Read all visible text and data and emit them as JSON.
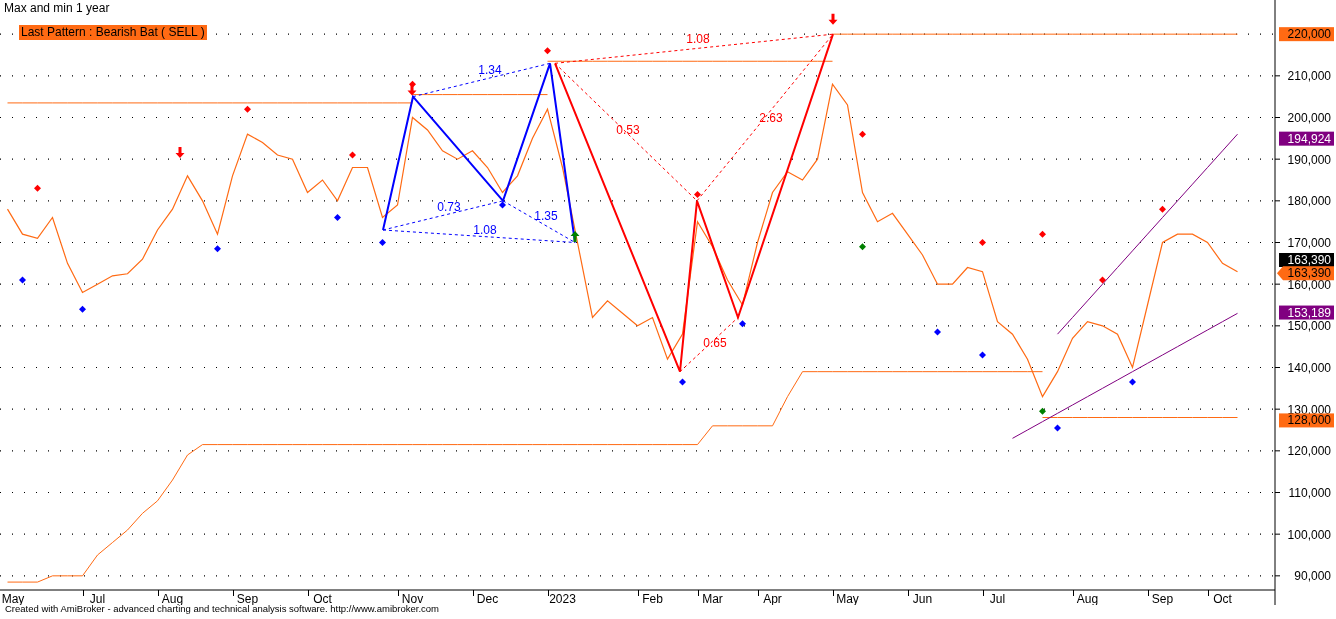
{
  "title": "Max and min 1 year",
  "pattern_badge": "Last Pattern : Bearish Bat ( SELL )",
  "chart_data": {
    "type": "line",
    "ylim": [
      86600,
      228200
    ],
    "grid": true,
    "categories": [
      "May",
      null,
      null,
      null,
      null,
      null,
      "Jul",
      null,
      null,
      null,
      null,
      "Aug",
      null,
      null,
      null,
      null,
      "Sep",
      null,
      null,
      null,
      null,
      "Oct",
      null,
      null,
      null,
      null,
      null,
      "Nov",
      null,
      null,
      null,
      null,
      "Dec",
      null,
      null,
      null,
      null,
      "2023",
      null,
      null,
      null,
      null,
      null,
      "Feb",
      null,
      null,
      null,
      "Mar",
      null,
      null,
      null,
      "Apr",
      null,
      null,
      null,
      null,
      "May",
      null,
      null,
      null,
      null,
      "Jun",
      null,
      null,
      null,
      null,
      "Jul",
      null,
      null,
      null,
      null,
      null,
      "Aug",
      null,
      null,
      null,
      null,
      "Sep",
      null,
      null,
      null,
      "Oct",
      null,
      null,
      null
    ],
    "yticks": [
      {
        "value": 90000,
        "label": "90,000"
      },
      {
        "value": 100000,
        "label": "100,000"
      },
      {
        "value": 110000,
        "label": "110,000"
      },
      {
        "value": 120000,
        "label": "120,000"
      },
      {
        "value": 130000,
        "label": "130,000"
      },
      {
        "value": 140000,
        "label": "140,000"
      },
      {
        "value": 150000,
        "label": "150,000"
      },
      {
        "value": 160000,
        "label": "160,000"
      },
      {
        "value": 170000,
        "label": "170,000"
      },
      {
        "value": 180000,
        "label": "180,000"
      },
      {
        "value": 190000,
        "label": "190,000"
      },
      {
        "value": 200000,
        "label": "200,000"
      },
      {
        "value": 210000,
        "label": "210,000"
      }
    ],
    "series": [
      {
        "color": "#ff6a13",
        "values": [
          178000,
          172000,
          171000,
          176000,
          165000,
          158000,
          160000,
          162000,
          162500,
          166000,
          173000,
          178000,
          186000,
          180000,
          172000,
          186000,
          196000,
          194000,
          191000,
          190000,
          182000,
          185000,
          180000,
          188000,
          188000,
          176000,
          179000,
          200000,
          197000,
          192000,
          190000,
          192000,
          188000,
          182000,
          186000,
          195000,
          202000,
          188000,
          170000,
          152000,
          156000,
          153000,
          150000,
          152000,
          142000,
          148000,
          175000,
          169000,
          161000,
          155000,
          170000,
          182000,
          187000,
          185000,
          190000,
          208000,
          203000,
          182000,
          175000,
          177000,
          172000,
          167000,
          160000,
          160000,
          164000,
          163000,
          151000,
          148000,
          142000,
          133000,
          139000,
          147000,
          151000,
          150000,
          148000,
          140000,
          155000,
          170000,
          172000,
          172000,
          170000,
          165000,
          163000,
          null,
          null
        ]
      },
      {
        "color": "#ff6a13",
        "values": [
          88500,
          88500,
          88500,
          90000,
          90000,
          90000,
          95000,
          98000,
          101000,
          105000,
          108000,
          113000,
          119000,
          121500,
          121500,
          121500,
          121500,
          121500,
          121500,
          121500,
          121500,
          121500,
          121500,
          121500,
          121500,
          121500,
          121500,
          121500,
          121500,
          121500,
          121500,
          121500,
          121500,
          121500,
          121500,
          121500,
          121500,
          121500,
          121500,
          121500,
          121500,
          121500,
          121500,
          121500,
          121500,
          121500,
          121500,
          126000,
          126000,
          126000,
          126000,
          126000,
          133000,
          139000,
          139000,
          139000,
          139000,
          139000,
          139000,
          139000,
          139000,
          139000,
          139000,
          139000,
          139000,
          139000,
          139000,
          139000,
          139000,
          139000,
          null,
          null,
          null,
          null,
          null,
          null,
          null,
          null,
          null,
          null,
          null,
          null,
          null,
          null,
          null
        ]
      },
      {
        "color": "#ff6a13",
        "values": [
          203500,
          203500,
          203500,
          203500,
          203500,
          203500,
          203500,
          203500,
          203500,
          203500,
          203500,
          203500,
          203500,
          203500,
          203500,
          203500,
          203500,
          203500,
          203500,
          203500,
          203500,
          203500,
          203500,
          203500,
          203500,
          203500,
          203500,
          203500,
          null,
          null,
          null,
          null,
          null,
          null,
          null,
          null,
          null,
          null,
          null,
          null,
          null,
          null,
          null,
          null,
          null,
          null,
          null,
          null,
          null,
          null,
          null,
          null,
          null,
          null,
          null,
          null,
          null,
          null,
          null,
          null,
          null,
          null,
          null,
          null,
          null,
          null,
          null,
          null,
          null,
          null,
          null,
          null,
          null,
          null,
          null,
          null,
          null,
          null,
          null,
          null,
          null,
          null,
          null,
          null,
          null
        ]
      },
      {
        "color": "#ff6a13",
        "values": [
          null,
          null,
          null,
          null,
          null,
          null,
          null,
          null,
          null,
          null,
          null,
          null,
          null,
          null,
          null,
          null,
          null,
          null,
          null,
          null,
          null,
          null,
          null,
          null,
          null,
          null,
          null,
          205500,
          205500,
          205500,
          205500,
          205500,
          205500,
          205500,
          205500,
          205500,
          205500,
          null,
          null,
          null,
          null,
          null,
          null,
          null,
          null,
          null,
          null,
          null,
          null,
          null,
          null,
          null,
          null,
          null,
          null,
          null,
          null,
          null,
          null,
          null,
          null,
          null,
          null,
          null,
          null,
          null,
          null,
          null,
          null,
          null,
          null,
          null,
          null,
          null,
          null,
          null,
          null,
          null,
          null,
          null,
          null,
          null,
          null,
          null,
          null
        ]
      },
      {
        "color": "#ff6a13",
        "values": [
          null,
          null,
          null,
          null,
          null,
          null,
          null,
          null,
          null,
          null,
          null,
          null,
          null,
          null,
          null,
          null,
          null,
          null,
          null,
          null,
          null,
          null,
          null,
          null,
          null,
          null,
          null,
          null,
          null,
          null,
          null,
          null,
          null,
          null,
          null,
          null,
          213500,
          213500,
          213500,
          213500,
          213500,
          213500,
          213500,
          213500,
          213500,
          213500,
          213500,
          213500,
          213500,
          213500,
          213500,
          213500,
          213500,
          213500,
          213500,
          213500,
          null,
          null,
          null,
          null,
          null,
          null,
          null,
          null,
          null,
          null,
          null,
          null,
          null,
          null,
          null,
          null,
          null,
          null,
          null,
          null,
          null,
          null,
          null,
          null,
          null,
          null,
          null,
          null,
          null
        ]
      },
      {
        "color": "#ff6a13",
        "values": [
          null,
          null,
          null,
          null,
          null,
          null,
          null,
          null,
          null,
          null,
          null,
          null,
          null,
          null,
          null,
          null,
          null,
          null,
          null,
          null,
          null,
          null,
          null,
          null,
          null,
          null,
          null,
          null,
          null,
          null,
          null,
          null,
          null,
          null,
          null,
          null,
          null,
          null,
          null,
          null,
          null,
          null,
          null,
          null,
          null,
          null,
          null,
          null,
          null,
          null,
          null,
          null,
          null,
          null,
          null,
          220000,
          220000,
          220000,
          220000,
          220000,
          220000,
          220000,
          220000,
          220000,
          220000,
          220000,
          220000,
          220000,
          220000,
          220000,
          220000,
          220000,
          220000,
          220000,
          220000,
          220000,
          220000,
          220000,
          220000,
          220000,
          220000,
          220000,
          220000,
          null,
          null
        ]
      },
      {
        "color": "#ff6a13",
        "values": [
          null,
          null,
          null,
          null,
          null,
          null,
          null,
          null,
          null,
          null,
          null,
          null,
          null,
          null,
          null,
          null,
          null,
          null,
          null,
          null,
          null,
          null,
          null,
          null,
          null,
          null,
          null,
          null,
          null,
          null,
          null,
          null,
          null,
          null,
          null,
          null,
          null,
          null,
          null,
          null,
          null,
          null,
          null,
          null,
          null,
          null,
          null,
          null,
          null,
          null,
          null,
          null,
          null,
          null,
          null,
          null,
          null,
          null,
          null,
          null,
          null,
          null,
          null,
          null,
          null,
          null,
          null,
          null,
          null,
          128000,
          128000,
          128000,
          128000,
          128000,
          128000,
          128000,
          128000,
          128000,
          128000,
          128000,
          128000,
          128000,
          128000,
          null,
          null
        ]
      },
      {
        "color": "#800080",
        "values": [
          null,
          null,
          null,
          null,
          null,
          null,
          null,
          null,
          null,
          null,
          null,
          null,
          null,
          null,
          null,
          null,
          null,
          null,
          null,
          null,
          null,
          null,
          null,
          null,
          null,
          null,
          null,
          null,
          null,
          null,
          null,
          null,
          null,
          null,
          null,
          null,
          null,
          null,
          null,
          null,
          null,
          null,
          null,
          null,
          null,
          null,
          null,
          null,
          null,
          null,
          null,
          null,
          null,
          null,
          null,
          null,
          null,
          null,
          null,
          null,
          null,
          null,
          null,
          null,
          null,
          null,
          null,
          null,
          null,
          null,
          148000,
          152000,
          156000,
          160000,
          164000,
          168000,
          172000,
          176000,
          180000,
          184000,
          188000,
          192000,
          196000,
          null,
          null
        ]
      },
      {
        "color": "#800080",
        "values": [
          null,
          null,
          null,
          null,
          null,
          null,
          null,
          null,
          null,
          null,
          null,
          null,
          null,
          null,
          null,
          null,
          null,
          null,
          null,
          null,
          null,
          null,
          null,
          null,
          null,
          null,
          null,
          null,
          null,
          null,
          null,
          null,
          null,
          null,
          null,
          null,
          null,
          null,
          null,
          null,
          null,
          null,
          null,
          null,
          null,
          null,
          null,
          null,
          null,
          null,
          null,
          null,
          null,
          null,
          null,
          null,
          null,
          null,
          null,
          null,
          null,
          null,
          null,
          null,
          null,
          null,
          null,
          123000,
          125000,
          127000,
          129000,
          131000,
          133000,
          135000,
          137000,
          139000,
          141000,
          143000,
          145000,
          147000,
          149000,
          151000,
          153000,
          null,
          null
        ]
      },
      {
        "type": "scatter",
        "color": "#ff0000",
        "values": [
          null,
          null,
          183000,
          null,
          null,
          null,
          null,
          null,
          null,
          null,
          null,
          null,
          null,
          null,
          null,
          null,
          202000,
          null,
          null,
          null,
          null,
          null,
          null,
          191000,
          null,
          null,
          null,
          208000,
          null,
          null,
          null,
          null,
          null,
          null,
          null,
          null,
          216000,
          null,
          null,
          null,
          null,
          null,
          null,
          null,
          null,
          null,
          181500,
          null,
          null,
          null,
          null,
          null,
          null,
          null,
          null,
          null,
          null,
          196000,
          null,
          null,
          null,
          null,
          null,
          null,
          null,
          170000,
          null,
          null,
          null,
          172000,
          null,
          null,
          null,
          161000,
          null,
          null,
          null,
          178000,
          null,
          null,
          null,
          null,
          null,
          null,
          null
        ]
      },
      {
        "type": "scatter",
        "color": "#0000ff",
        "values": [
          null,
          161000,
          null,
          null,
          null,
          154000,
          null,
          null,
          null,
          null,
          null,
          null,
          null,
          null,
          168500,
          null,
          null,
          null,
          null,
          null,
          null,
          null,
          176000,
          null,
          null,
          170000,
          null,
          null,
          null,
          null,
          null,
          null,
          null,
          179000,
          null,
          null,
          null,
          null,
          null,
          null,
          null,
          null,
          null,
          null,
          null,
          136500,
          null,
          null,
          null,
          150500,
          null,
          null,
          null,
          null,
          null,
          null,
          null,
          null,
          null,
          null,
          null,
          null,
          148500,
          null,
          null,
          143000,
          null,
          null,
          null,
          null,
          125500,
          null,
          null,
          null,
          null,
          136500,
          null,
          null,
          null,
          null,
          null,
          null,
          null,
          null,
          null
        ]
      },
      {
        "type": "scatter",
        "color": "#008000",
        "values": [
          null,
          null,
          null,
          null,
          null,
          null,
          null,
          null,
          null,
          null,
          null,
          null,
          null,
          null,
          null,
          null,
          null,
          null,
          null,
          null,
          null,
          null,
          null,
          null,
          null,
          null,
          null,
          null,
          null,
          null,
          null,
          null,
          null,
          null,
          null,
          null,
          null,
          null,
          null,
          null,
          null,
          null,
          null,
          null,
          null,
          null,
          null,
          null,
          null,
          null,
          null,
          null,
          null,
          null,
          null,
          null,
          null,
          169000,
          null,
          null,
          null,
          null,
          null,
          null,
          null,
          null,
          null,
          null,
          null,
          129500,
          null,
          null,
          null,
          null,
          null,
          null,
          null,
          null,
          null,
          null,
          null,
          null,
          null,
          null,
          null
        ]
      }
    ],
    "annotations": [
      "1.34",
      "0.73",
      "1.08",
      "1.35",
      "1.08",
      "0.53",
      "2.63",
      "0.65"
    ]
  },
  "price_tags": [
    {
      "kind": "box",
      "text": "220,000",
      "color": "#ff6a13"
    },
    {
      "kind": "box",
      "text": "194,924",
      "color": "#800080"
    },
    {
      "kind": "box",
      "text": "163,390",
      "color": "#000000"
    },
    {
      "kind": "pointer",
      "text": "163,390",
      "color": "#ff6a13"
    },
    {
      "kind": "box",
      "text": "153,189",
      "color": "#800080"
    },
    {
      "kind": "box",
      "text": "128,000",
      "color": "#ff6a13"
    }
  ],
  "footer": "Created with AmiBroker - advanced charting and technical analysis software. http://www.amibroker.com"
}
